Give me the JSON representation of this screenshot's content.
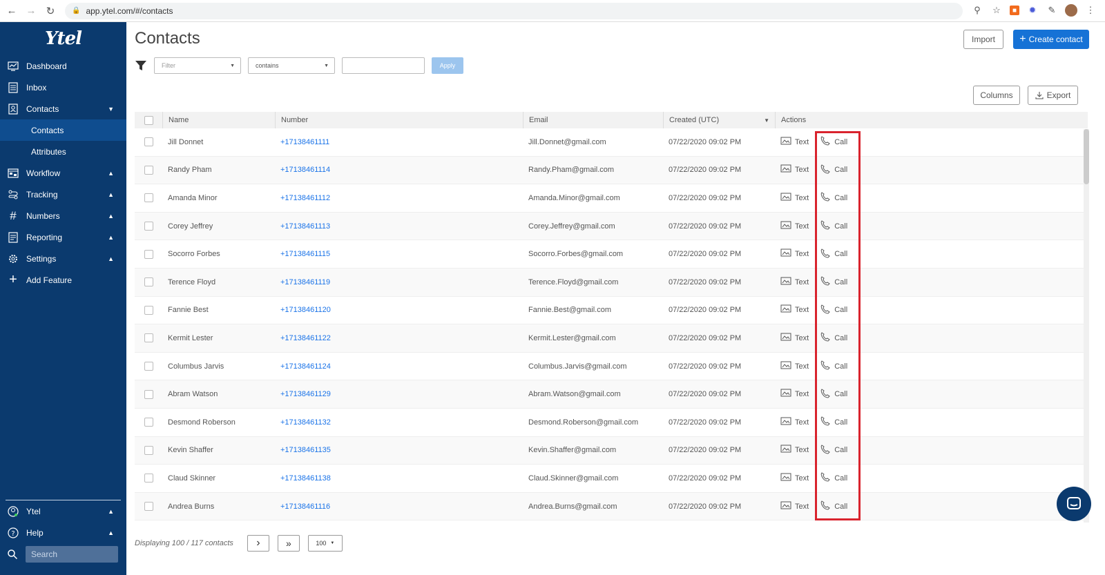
{
  "browser": {
    "url": "app.ytel.com/#/contacts"
  },
  "sidebar": {
    "logo": "Ytel",
    "items": [
      {
        "label": "Dashboard",
        "icon": "dashboard-icon"
      },
      {
        "label": "Inbox",
        "icon": "inbox-icon"
      },
      {
        "label": "Contacts",
        "icon": "contacts-icon"
      },
      {
        "label": "Workflow",
        "icon": "workflow-icon"
      },
      {
        "label": "Tracking",
        "icon": "tracking-icon"
      },
      {
        "label": "Numbers",
        "icon": "hash-icon"
      },
      {
        "label": "Reporting",
        "icon": "reporting-icon"
      },
      {
        "label": "Settings",
        "icon": "gear-icon"
      },
      {
        "label": "Add Feature",
        "icon": "plus-icon"
      }
    ],
    "sub_items": [
      {
        "label": "Contacts"
      },
      {
        "label": "Attributes"
      }
    ],
    "bottom": {
      "account": "Ytel",
      "help": "Help",
      "search_placeholder": "Search"
    }
  },
  "main": {
    "title": "Contacts",
    "import_label": "Import",
    "create_label": "Create contact",
    "filter_placeholder": "Filter",
    "operator": "contains",
    "apply_label": "Apply",
    "columns_label": "Columns",
    "export_label": "Export"
  },
  "table": {
    "headers": {
      "name": "Name",
      "number": "Number",
      "email": "Email",
      "created": "Created (UTC)",
      "actions": "Actions"
    },
    "text_action": "Text",
    "call_action": "Call",
    "rows": [
      {
        "name": "Jill Donnet",
        "number": "+17138461111",
        "email": "Jill.Donnet@gmail.com",
        "created": "07/22/2020 09:02 PM"
      },
      {
        "name": "Randy Pham",
        "number": "+17138461114",
        "email": "Randy.Pham@gmail.com",
        "created": "07/22/2020 09:02 PM"
      },
      {
        "name": "Amanda Minor",
        "number": "+17138461112",
        "email": "Amanda.Minor@gmail.com",
        "created": "07/22/2020 09:02 PM"
      },
      {
        "name": "Corey Jeffrey",
        "number": "+17138461113",
        "email": "Corey.Jeffrey@gmail.com",
        "created": "07/22/2020 09:02 PM"
      },
      {
        "name": "Socorro Forbes",
        "number": "+17138461115",
        "email": "Socorro.Forbes@gmail.com",
        "created": "07/22/2020 09:02 PM"
      },
      {
        "name": "Terence Floyd",
        "number": "+17138461119",
        "email": "Terence.Floyd@gmail.com",
        "created": "07/22/2020 09:02 PM"
      },
      {
        "name": "Fannie Best",
        "number": "+17138461120",
        "email": "Fannie.Best@gmail.com",
        "created": "07/22/2020 09:02 PM"
      },
      {
        "name": "Kermit Lester",
        "number": "+17138461122",
        "email": "Kermit.Lester@gmail.com",
        "created": "07/22/2020 09:02 PM"
      },
      {
        "name": "Columbus Jarvis",
        "number": "+17138461124",
        "email": "Columbus.Jarvis@gmail.com",
        "created": "07/22/2020 09:02 PM"
      },
      {
        "name": "Abram Watson",
        "number": "+17138461129",
        "email": "Abram.Watson@gmail.com",
        "created": "07/22/2020 09:02 PM"
      },
      {
        "name": "Desmond Roberson",
        "number": "+17138461132",
        "email": "Desmond.Roberson@gmail.com",
        "created": "07/22/2020 09:02 PM"
      },
      {
        "name": "Kevin Shaffer",
        "number": "+17138461135",
        "email": "Kevin.Shaffer@gmail.com",
        "created": "07/22/2020 09:02 PM"
      },
      {
        "name": "Claud Skinner",
        "number": "+17138461138",
        "email": "Claud.Skinner@gmail.com",
        "created": "07/22/2020 09:02 PM"
      },
      {
        "name": "Andrea Burns",
        "number": "+17138461116",
        "email": "Andrea.Burns@gmail.com",
        "created": "07/22/2020 09:02 PM"
      }
    ]
  },
  "footer": {
    "displaying": "Displaying 100 / 117 contacts",
    "next": "›",
    "last": "»",
    "page_size": "100"
  },
  "colors": {
    "sidebar_bg": "#0b3a6e",
    "primary": "#1672d6",
    "link": "#1a73e8",
    "highlight": "#d9232d"
  }
}
